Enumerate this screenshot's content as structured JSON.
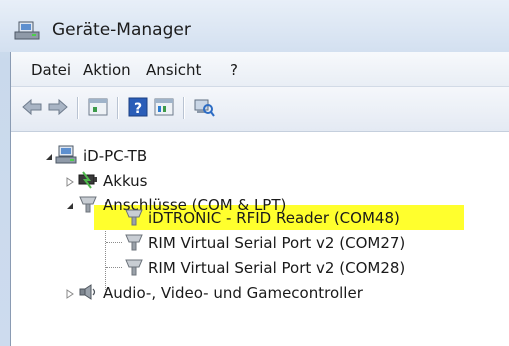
{
  "window": {
    "title": "Geräte-Manager"
  },
  "menu": [
    "Datei",
    "Aktion",
    "Ansicht",
    "?"
  ],
  "toolbar": {
    "icons": [
      "back-arrow-icon",
      "forward-arrow-icon",
      "properties-icon",
      "help-icon",
      "details-icon",
      "scan-hardware-icon"
    ]
  },
  "tree": {
    "root": "iD-PC-TB",
    "akkus": "Akkus",
    "ports": "Anschlüsse (COM & LPT)",
    "port_items": [
      "iDTRONIC - RFID Reader (COM48)",
      "RIM Virtual Serial Port v2 (COM27)",
      "RIM Virtual Serial Port v2 (COM28)"
    ],
    "audio": "Audio-, Video- und Gamecontroller"
  },
  "colors": {
    "highlight": "#ffff2d"
  }
}
